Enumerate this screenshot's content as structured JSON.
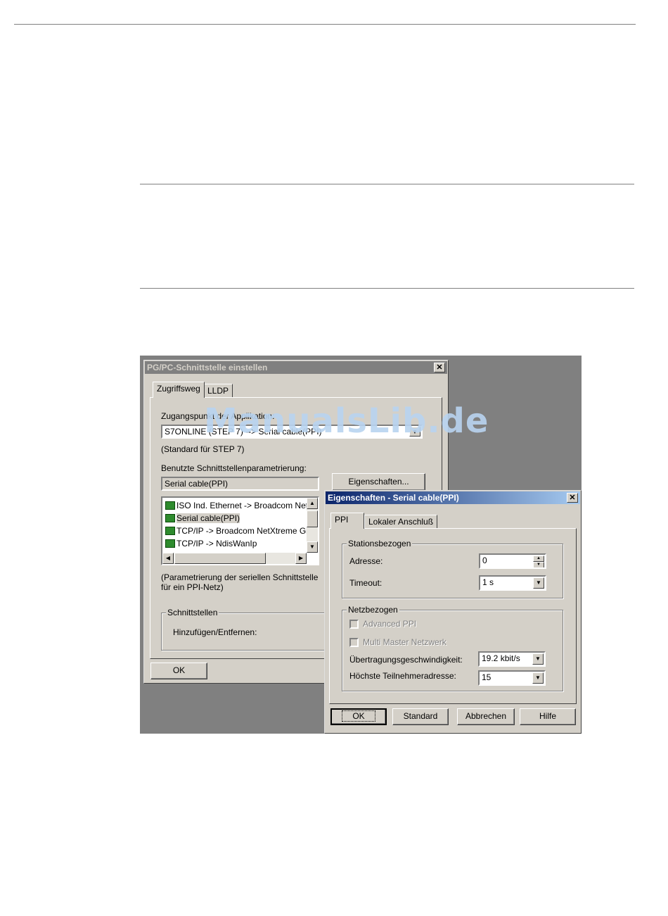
{
  "watermark": "ManualsLib.de",
  "dialog_pgpc": {
    "title": "PG/PC-Schnittstelle einstellen",
    "close": "✕",
    "tabs": [
      {
        "label": "Zugriffsweg",
        "selected": true
      },
      {
        "label": "LLDP",
        "selected": false
      }
    ],
    "access_point_label": "Zugangspunkt der Applikation:",
    "access_point_value": "S7ONLINE (STEP 7) --> Serial cable(PPI)",
    "standard_hint": "(Standard für STEP 7)",
    "param_label": "Benutzte Schnittstellenparametrierung:",
    "param_value": "Serial cable(PPI)",
    "properties_button": "Eigenschaften...",
    "interface_list": [
      {
        "label": "ISO Ind. Ethernet -> Broadcom NetX",
        "icon": "network-adapter-icon"
      },
      {
        "label": "Serial cable(PPI)",
        "icon": "network-adapter-icon",
        "selected": true
      },
      {
        "label": "TCP/IP -> Broadcom NetXtreme Gi",
        "icon": "network-adapter-icon"
      },
      {
        "label": "TCP/IP -> NdisWanIp",
        "icon": "network-adapter-icon"
      }
    ],
    "description_line1": "(Parametrierung der seriellen Schnittstelle",
    "description_line2": "für ein PPI-Netz)",
    "interfaces_group": "Schnittstellen",
    "add_remove_label": "Hinzufügen/Entfernen:",
    "ok_button": "OK"
  },
  "dialog_props": {
    "title": "Eigenschaften - Serial cable(PPI)",
    "close": "✕",
    "tabs": [
      {
        "label": "PPI",
        "selected": true
      },
      {
        "label": "Lokaler Anschluß",
        "selected": false
      }
    ],
    "station_group": "Stationsbezogen",
    "address_label": "Adresse:",
    "address_value": "0",
    "timeout_label": "Timeout:",
    "timeout_value": "1 s",
    "network_group": "Netzbezogen",
    "advanced_ppi_label": "Advanced PPI",
    "advanced_ppi_checked": false,
    "multi_master_label": "Multi Master Netzwerk",
    "multi_master_checked": false,
    "speed_label": "Übertragungsgeschwindigkeit:",
    "speed_value": "19.2 kbit/s",
    "highest_address_label": "Höchste Teilnehmeradresse:",
    "highest_address_value": "15",
    "buttons": {
      "ok": "OK",
      "standard": "Standard",
      "cancel": "Abbrechen",
      "help": "Hilfe"
    }
  }
}
